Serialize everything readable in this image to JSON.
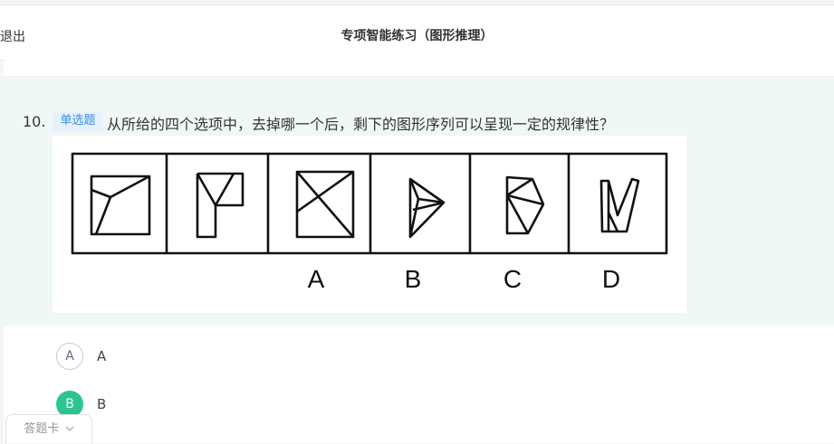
{
  "header": {
    "back_label": "退出",
    "title": "专项智能练习（图形推理）"
  },
  "question": {
    "number": "10.",
    "type_badge": "单选题",
    "text": "从所给的四个选项中，去掉哪一个后，剩下的图形序列可以呈现一定的规律性？",
    "figure_labels": [
      "A",
      "B",
      "C",
      "D"
    ]
  },
  "options": [
    {
      "letter": "A",
      "label": "A",
      "selected": false
    },
    {
      "letter": "B",
      "label": "B",
      "selected": true
    }
  ],
  "footer": {
    "answer_sheet_label": "答题卡"
  },
  "colors": {
    "selected": "#2dc58f",
    "badge_text": "#3a8ee6",
    "question_bg": "#f0f8f5"
  }
}
